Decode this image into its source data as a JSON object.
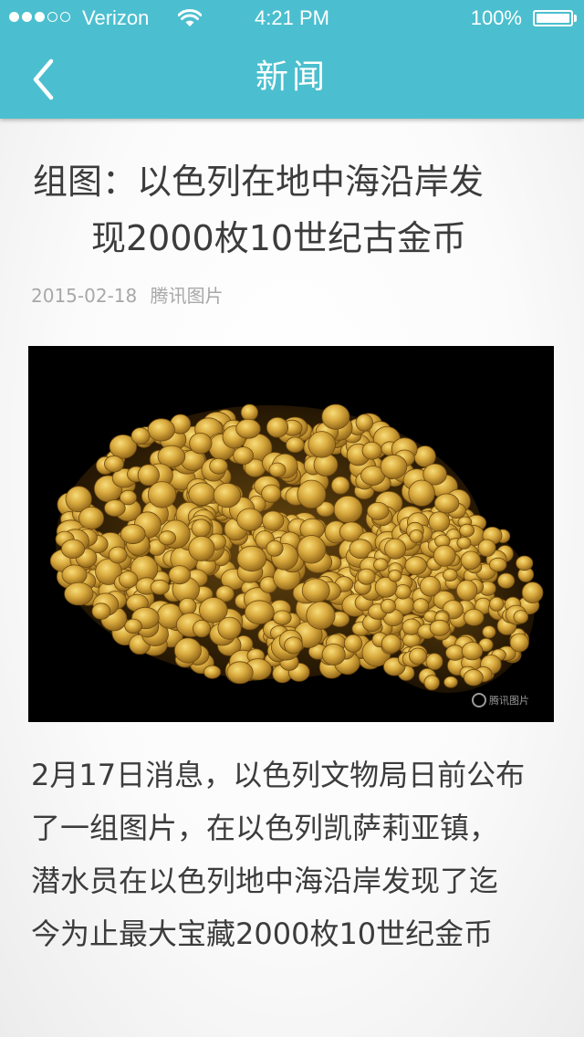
{
  "status_bar": {
    "carrier": "Verizon",
    "time": "4:21 PM",
    "battery": "100%",
    "signal_bars_filled": 3,
    "signal_bars_total": 5
  },
  "nav": {
    "title": "新闻",
    "back_icon": "chevron-left-icon"
  },
  "article": {
    "title_line1": "组图：以色列在地中海沿岸发",
    "title_line2": "现2000枚10世纪古金币",
    "date": "2015-02-18",
    "source": "腾讯图片",
    "image_watermark": "腾讯图片",
    "body_lines": [
      "2月17日消息，以色列文物局日前公布",
      "了一组图片，在以色列凯萨莉亚镇，",
      "潜水员在以色列地中海沿岸发现了迄",
      "今为止最大宝藏2000枚10世纪金币"
    ]
  },
  "colors": {
    "header": "#4bbfcf",
    "text": "#3c3c3c",
    "meta": "#a8a8a8",
    "coin_gold": "#d4a53a"
  }
}
